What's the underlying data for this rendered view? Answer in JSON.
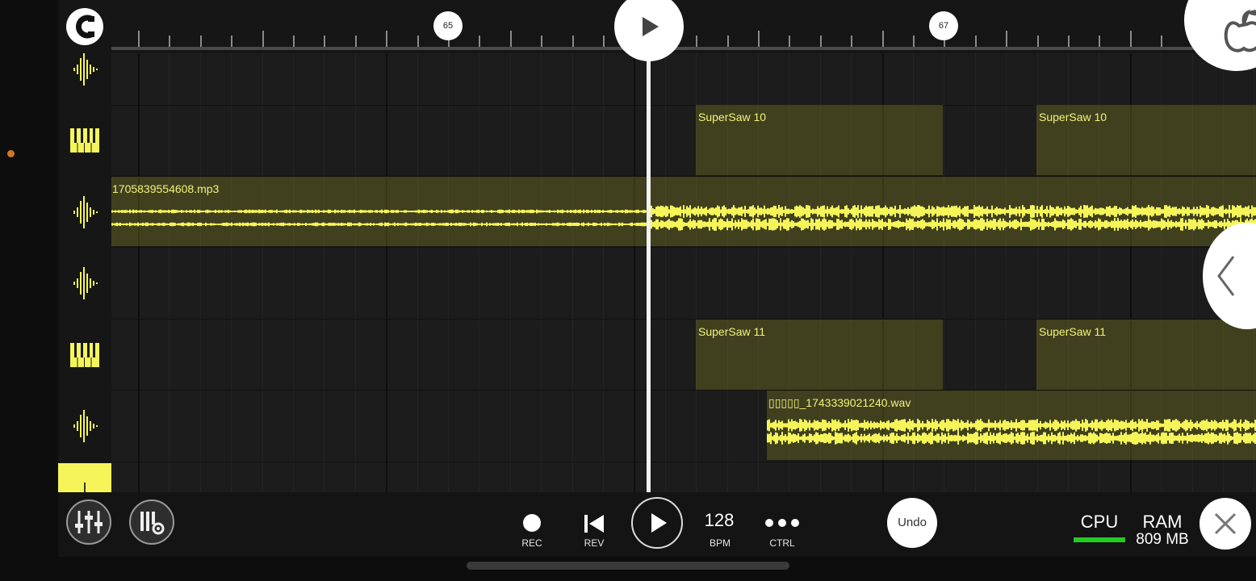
{
  "ruler": {
    "bar_markers": [
      {
        "label": "65"
      },
      {
        "label": "67"
      }
    ]
  },
  "icons": {
    "snap": "magnet-snap-icon",
    "play": "play-icon",
    "logo": "fl-fruit-logo-icon",
    "collapse": "chevron-left-icon",
    "mixer": "mixer-faders-icon",
    "piano_settings": "piano-settings-icon",
    "close": "close-icon"
  },
  "tracks": [
    {
      "type": "audio",
      "icon": "waveform-icon"
    },
    {
      "type": "instrument",
      "icon": "piano-keys-icon"
    },
    {
      "type": "audio",
      "icon": "waveform-icon"
    },
    {
      "type": "audio",
      "icon": "waveform-icon"
    },
    {
      "type": "instrument",
      "icon": "piano-keys-icon"
    },
    {
      "type": "audio",
      "icon": "waveform-icon"
    },
    {
      "type": "selected",
      "icon": "waveform-icon"
    }
  ],
  "clips": [
    {
      "label": "SuperSaw 10"
    },
    {
      "label": "SuperSaw 10"
    },
    {
      "label": "1705839554608.mp3"
    },
    {
      "label": "SuperSaw 11"
    },
    {
      "label": "SuperSaw 11"
    },
    {
      "label": "▯▯▯▯▯_1743339021240.wav"
    }
  ],
  "transport": {
    "rec_label": "REC",
    "rev_label": "REV",
    "bpm_value": "128",
    "bpm_label": "BPM",
    "ctrl_label": "CTRL",
    "undo_label": "Undo"
  },
  "status": {
    "cpu_label": "CPU",
    "ram_label": "RAM",
    "ram_value": "809 MB"
  },
  "colors": {
    "accent_yellow": "#f5f55a",
    "clip_fill": "#3b3a1c",
    "cpu_meter": "#22cc22",
    "background": "#1a1a1a"
  }
}
